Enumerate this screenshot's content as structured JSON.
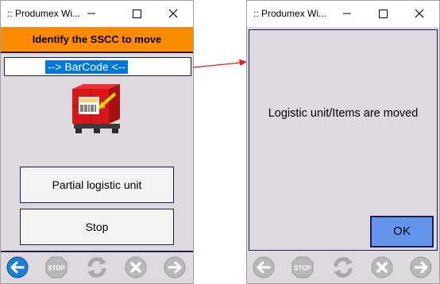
{
  "window1": {
    "title": ":: Produmex Wi...",
    "header": "Identify the SSCC to move",
    "barcode_value": "--> BarCode <--",
    "buttons": {
      "partial": "Partial logistic unit",
      "stop": "Stop"
    },
    "nav_icons": [
      "back-arrow-icon",
      "stop-sign-icon",
      "refresh-icon",
      "cancel-icon",
      "forward-arrow-icon"
    ]
  },
  "window2": {
    "title": ":: Produmex Wi...",
    "message": "Logistic unit/Items are moved",
    "ok_label": "OK",
    "nav_icons": [
      "back-arrow-icon",
      "stop-sign-icon",
      "refresh-icon",
      "cancel-icon",
      "forward-arrow-icon"
    ]
  },
  "nav_stop_label": "STOP",
  "colors": {
    "header_orange": "#ff8c00",
    "panel_gray": "#ddd9de",
    "selection_blue": "#0078d7",
    "ok_blue": "#6495ed",
    "back_icon_blue": "#1e7fd6",
    "arrow_red": "#e02020",
    "border_navy": "#1c1c50"
  }
}
